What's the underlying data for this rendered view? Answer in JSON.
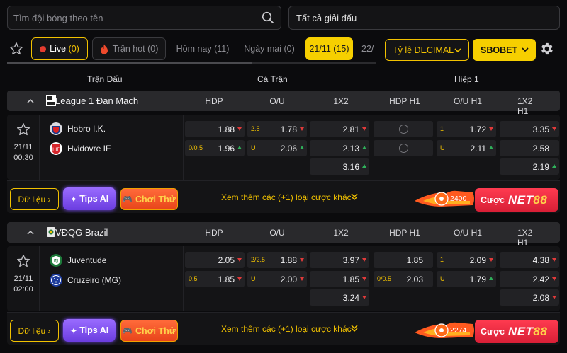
{
  "search": {
    "placeholder": "Tìm đội bóng theo tên"
  },
  "league_filter": {
    "value": "Tất cả giải đấu"
  },
  "tabs": [
    {
      "label": "Live",
      "count": "(0)"
    },
    {
      "label": "Trận hot",
      "count": "(0)"
    },
    {
      "label": "Hôm nay (11)"
    },
    {
      "label": "Ngày mai (0)"
    },
    {
      "label": "21/11 (15)"
    },
    {
      "label": "22/"
    }
  ],
  "odds_format": {
    "label": "Tỷ lệ DECIMAL"
  },
  "bookmaker": {
    "label": "SBOBET"
  },
  "columns": {
    "match": "Trận Đấu",
    "full": "Cả Trận",
    "half": "Hiệp 1"
  },
  "market_headers": [
    "HDP",
    "O/U",
    "1X2",
    "HDP H1",
    "O/U H1",
    "1X2 H1"
  ],
  "market_headers_2": [
    "HDP",
    "O/U",
    "1X2",
    "HDP H1",
    "O/U H1",
    "1X2 H1"
  ],
  "leagues": [
    {
      "name": "League 1 Đan Mạch",
      "match": {
        "date": "21/11",
        "time": "00:30",
        "home": "Hobro I.K.",
        "away": "Hvidovre IF",
        "hdp": {
          "home": {
            "hc": "",
            "odd": "1.88"
          },
          "away": {
            "hc": "0/0.5",
            "odd": "1.96"
          }
        },
        "ou": {
          "over": {
            "hc": "2.5",
            "odd": "1.78"
          },
          "under": {
            "hc": "U",
            "odd": "2.06"
          }
        },
        "x12": [
          "2.81",
          "2.13",
          "3.16"
        ],
        "ou_h1": {
          "over": {
            "hc": "1",
            "odd": "1.72"
          },
          "under": {
            "hc": "U",
            "odd": "2.11"
          }
        },
        "x12_h1": [
          "3.35",
          "2.58",
          "2.19"
        ]
      },
      "more_label": "Xem thêm các (+1) loại cược khác",
      "promo_count": "2400"
    },
    {
      "name": "VĐQG Brazil",
      "match": {
        "date": "21/11",
        "time": "02:00",
        "home": "Juventude",
        "away": "Cruzeiro (MG)",
        "hdp": {
          "home": {
            "hc": "",
            "odd": "2.05"
          },
          "away": {
            "hc": "0.5",
            "odd": "1.85"
          }
        },
        "ou": {
          "over": {
            "hc": "2/2.5",
            "odd": "1.88"
          },
          "under": {
            "hc": "U",
            "odd": "2.00"
          }
        },
        "x12": [
          "3.97",
          "1.85",
          "3.24"
        ],
        "hdp_h1": {
          "home": {
            "hc": "",
            "odd": "1.85"
          },
          "away": {
            "hc": "0/0.5",
            "odd": "2.03"
          }
        },
        "ou_h1": {
          "over": {
            "hc": "1",
            "odd": "2.09"
          },
          "under": {
            "hc": "U",
            "odd": "1.79"
          }
        },
        "x12_h1": [
          "4.38",
          "2.42",
          "2.08"
        ]
      },
      "more_label": "Xem thêm các (+1) loại cược khác",
      "promo_count": "2274"
    }
  ],
  "buttons": {
    "data": "Dữ liệu",
    "tips": "Tips AI",
    "play": "Chơi Thử",
    "bet": "Cược",
    "brand": "NET",
    "brand_num": "88"
  }
}
